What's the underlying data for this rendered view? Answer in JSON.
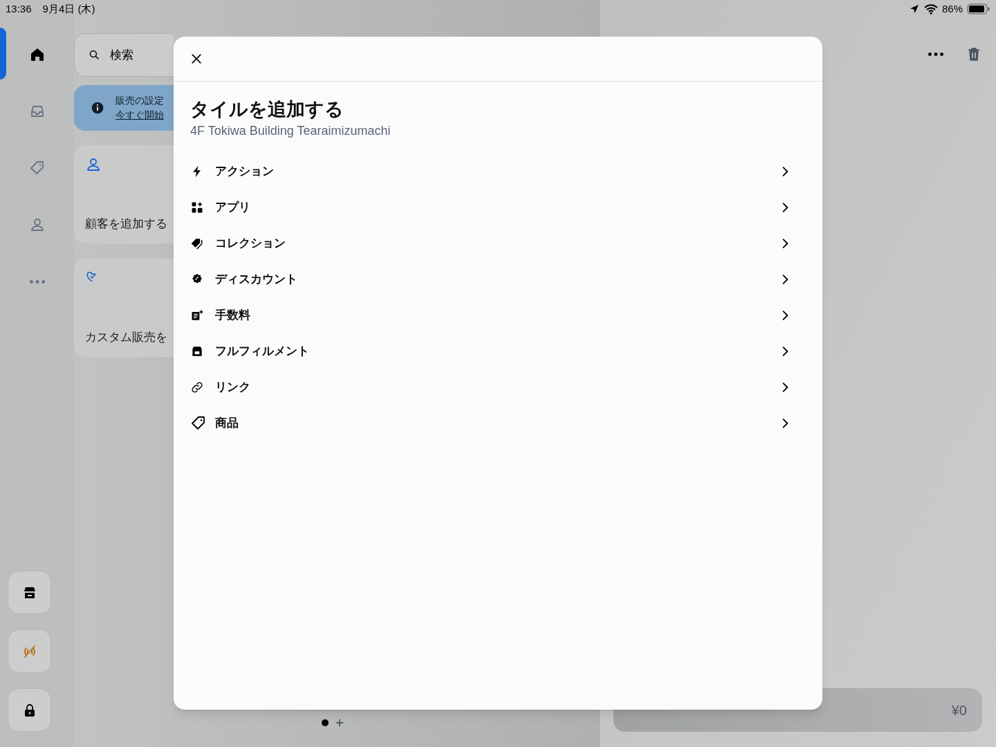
{
  "status_bar": {
    "time": "13:36",
    "date": "9月4日 (木)",
    "battery": "86%"
  },
  "sidebar": {
    "items": [
      {
        "kind": "home",
        "selected": true
      },
      {
        "kind": "inbox",
        "selected": false
      },
      {
        "kind": "tag",
        "selected": false
      },
      {
        "kind": "person",
        "selected": false
      },
      {
        "kind": "more",
        "selected": false
      }
    ],
    "bottom_buttons": [
      {
        "kind": "store"
      },
      {
        "kind": "offline"
      },
      {
        "kind": "lock"
      }
    ]
  },
  "search": {
    "placeholder": "検索"
  },
  "banner": {
    "text": "販売の設定",
    "link": "今すぐ開始"
  },
  "tiles": [
    {
      "kind": "person",
      "label": "顧客を追加する"
    },
    {
      "kind": "heart",
      "label": "カスタム販売を"
    }
  ],
  "page_indicator": {
    "pages": [
      {
        "selected": true
      }
    ]
  },
  "modal": {
    "title": "タイルを追加する",
    "subtitle": "4F Tokiwa Building Tearaimizumachi",
    "items": [
      {
        "kind": "bolt",
        "label": "アクション"
      },
      {
        "kind": "apps",
        "label": "アプリ"
      },
      {
        "kind": "tags",
        "label": "コレクション"
      },
      {
        "kind": "discount",
        "label": "ディスカウント"
      },
      {
        "kind": "fee",
        "label": "手数料"
      },
      {
        "kind": "box",
        "label": "フルフィルメント"
      },
      {
        "kind": "link",
        "label": "リンク"
      },
      {
        "kind": "tag",
        "label": "商品"
      }
    ]
  },
  "checkout": {
    "amount": "¥0"
  }
}
